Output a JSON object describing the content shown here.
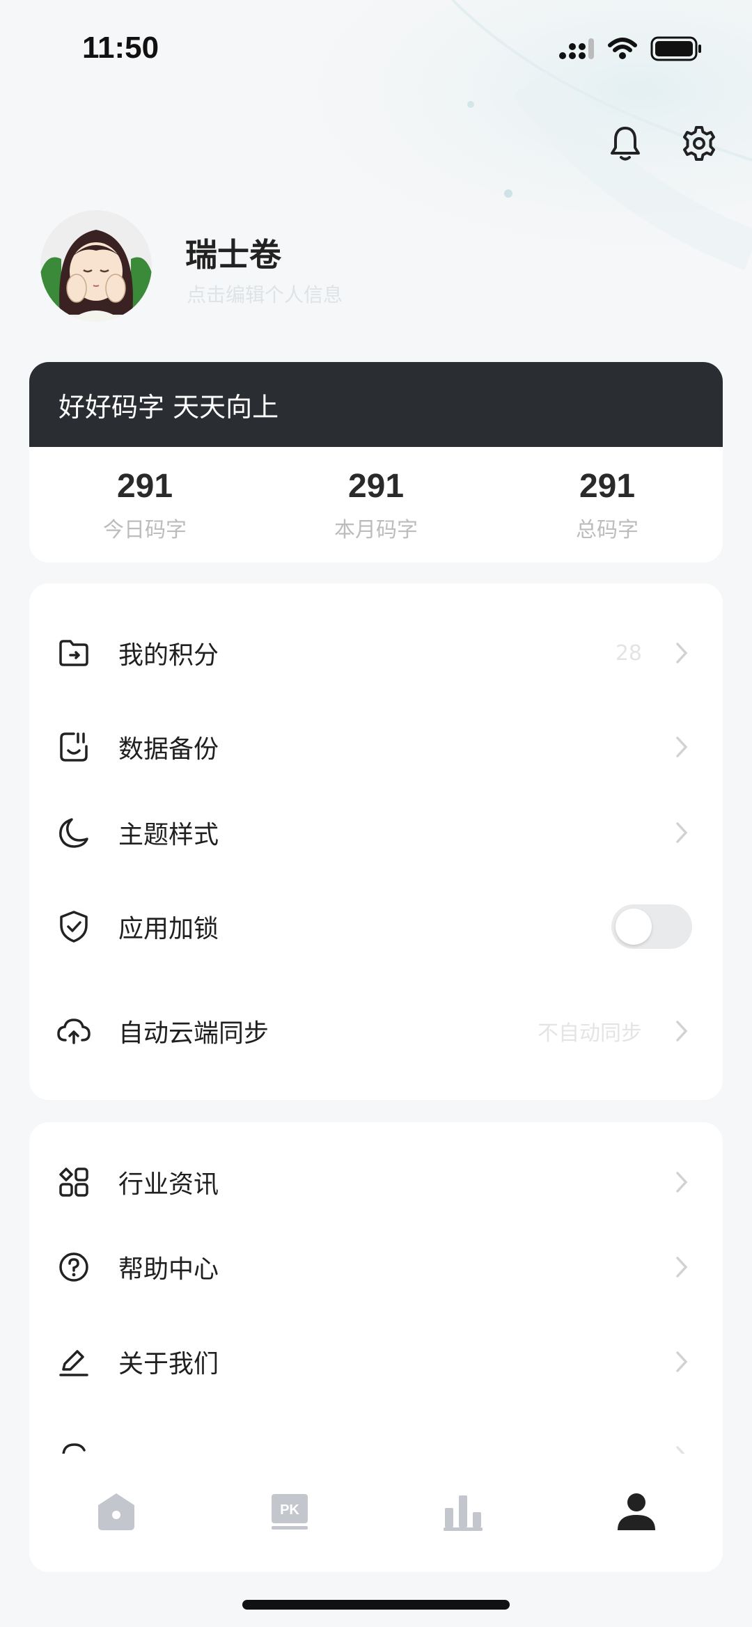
{
  "status_bar": {
    "time": "11:50"
  },
  "header": {
    "icons": [
      "bell-icon",
      "gear-icon"
    ]
  },
  "profile": {
    "name": "瑞士卷",
    "subtitle": "点击编辑个人信息"
  },
  "motto": "好好码字 天天向上",
  "stats": [
    {
      "value": "291",
      "label": "今日码字"
    },
    {
      "value": "291",
      "label": "本月码字"
    },
    {
      "value": "291",
      "label": "总码字"
    }
  ],
  "menu_group_1": [
    {
      "label": "我的积分",
      "value": "28",
      "icon": "folder-icon"
    },
    {
      "label": "数据备份",
      "value": "",
      "icon": "backup-icon"
    },
    {
      "label": "主题样式",
      "value": "",
      "icon": "moon-icon"
    },
    {
      "label": "应用加锁",
      "toggle_on": false,
      "icon": "shield-check-icon"
    },
    {
      "label": "自动云端同步",
      "value": "不自动同步",
      "icon": "cloud-upload-icon"
    }
  ],
  "menu_group_2": [
    {
      "label": "行业资讯",
      "icon": "grid-icon"
    },
    {
      "label": "帮助中心",
      "icon": "help-circle-icon"
    },
    {
      "label": "关于我们",
      "icon": "pencil-icon"
    }
  ],
  "tabbar": {
    "tabs": [
      {
        "name": "home",
        "icon": "home-icon",
        "active": false
      },
      {
        "name": "pk",
        "icon": "pk-icon",
        "badge_text": "PK",
        "active": false
      },
      {
        "name": "stats",
        "icon": "bar-chart-icon",
        "active": false
      },
      {
        "name": "profile",
        "icon": "person-icon",
        "active": true
      }
    ]
  },
  "colors": {
    "background": "#f6f7f8",
    "motto_bar": "#2a2d32",
    "text_primary": "#1f1f1f",
    "text_muted": "#bcbcbc",
    "tab_inactive": "#c3c7cd",
    "tab_active": "#222222"
  }
}
